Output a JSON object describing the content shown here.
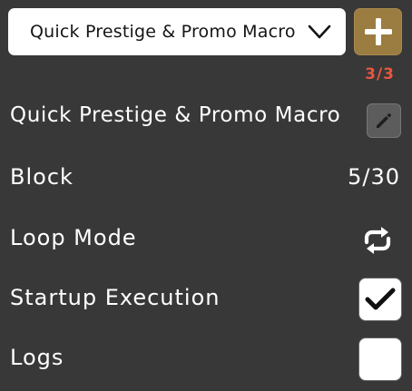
{
  "macro_selector": {
    "selected": "Quick Prestige & Promo Macro",
    "icon": "chevron-down-icon"
  },
  "add_button": {
    "icon": "plus-icon",
    "color": "#9b7c41"
  },
  "counter": {
    "text": "3/3",
    "color": "#e8573f"
  },
  "macro": {
    "name": "Quick Prestige & Promo Macro",
    "edit_icon": "pencil-icon"
  },
  "rows": {
    "block": {
      "label": "Block",
      "value": "5/30"
    },
    "loop_mode": {
      "label": "Loop Mode",
      "icon": "repeat-icon"
    },
    "startup_execution": {
      "label": "Startup Execution",
      "checked": true
    },
    "logs": {
      "label": "Logs",
      "checked": false
    }
  },
  "colors": {
    "background": "#383838",
    "text": "#ffffff"
  }
}
